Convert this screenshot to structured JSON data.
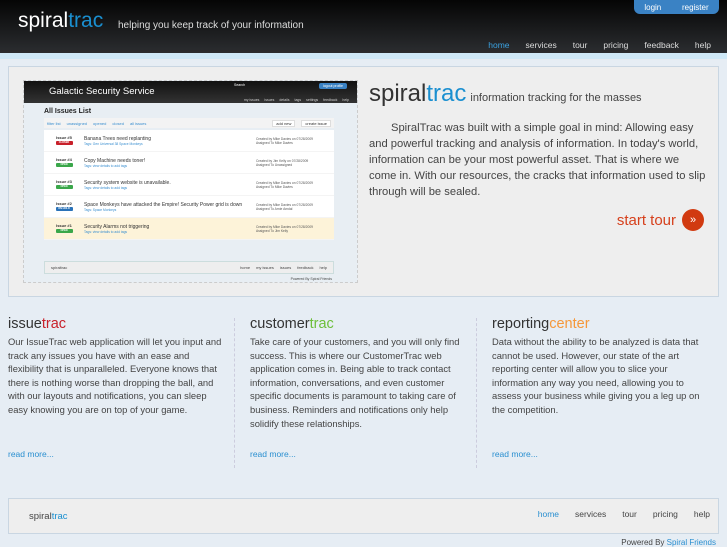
{
  "header": {
    "logo_a": "spiral",
    "logo_b": "trac",
    "tagline": "helping you keep track of your information",
    "login": "login",
    "register": "register",
    "nav": [
      "home",
      "services",
      "tour",
      "pricing",
      "feedback",
      "help"
    ],
    "active": "home"
  },
  "hero": {
    "title_a": "spiral",
    "title_b": "trac",
    "subtitle": "information tracking for the masses",
    "text": "SpiralTrac was built with a simple goal in mind: Allowing easy and powerful tracking and analysis of information. In today's world, information can be your most powerful asset. That is where we come in. With our resources, the cracks that information used to slip through will be sealed.",
    "cta": "start tour",
    "cta_icon": "»",
    "screenshot": {
      "title": "Galactic Security Service",
      "search": "Search",
      "auth": "logout  profile",
      "nav": [
        "my issues",
        "issues",
        "details",
        "tags",
        "settings",
        "feedback",
        "help"
      ],
      "list_title": "All Issues List",
      "filters": [
        "filter list",
        "unassigned",
        "opened",
        "closed",
        "all issues"
      ],
      "buttons": [
        "add new",
        "create issue"
      ],
      "issues": [
        {
          "num": "Issue #5",
          "status": "CLOSED",
          "color": "#c8202a",
          "title": "Banana Trees need replanting",
          "tags": "Tags:  Gen Universal 38  Space Monkeys",
          "created": "Created by Mike Davies on 07/28/2009",
          "assigned": "Assigned To Mike Davies"
        },
        {
          "num": "Issue #4",
          "status": "OPEN",
          "color": "#3aa74a",
          "title": "Copy Machine needs toner!",
          "tags": "Tags:  view details to add tags",
          "created": "Created by Jim Kelly on 07/28/2009",
          "assigned": "Assigned To Unassigned"
        },
        {
          "num": "Issue #3",
          "status": "OPEN",
          "color": "#3aa74a",
          "title": "Security system website is unavailable.",
          "tags": "Tags:  view details to add tags",
          "created": "Created by Mike Davies on 07/28/2009",
          "assigned": "Assigned To Mike Davies"
        },
        {
          "num": "Issue #2",
          "status": "ON HOLD",
          "color": "#2a72b8",
          "title": "Space Monkeys have attacked the Empire! Security Power grid is down",
          "tags": "Tags:  Space Monkeys",
          "created": "Created by Mike Davies on 07/28/2009",
          "assigned": "Assigned To Arnie Amdal"
        },
        {
          "num": "Issue #1",
          "status": "OPEN",
          "color": "#3aa74a",
          "title": "Security Alarms not triggering",
          "tags": "Tags:  view details to add tags",
          "created": "Created by Mike Davies on 07/28/2009",
          "assigned": "Assigned To Jim Kelly"
        }
      ],
      "footer_logo": "spiraltrac",
      "footer_nav": [
        "home",
        "my issues",
        "issues",
        "feedback",
        "help"
      ],
      "powered": "Powered By Spiral Friends"
    }
  },
  "columns": [
    {
      "title_a": "issue",
      "title_b": "trac",
      "accent": "#c8202a",
      "text": "Our IssueTrac web application will let you input and track any issues you have with an ease and flexibility that is unparalleled. Everyone knows that there is nothing worse than dropping the ball, and with our layouts and notifications, you can sleep easy knowing you are on top of your game.",
      "link": "read more..."
    },
    {
      "title_a": "customer",
      "title_b": "trac",
      "accent": "#6cbf3a",
      "text": "Take care of your customers, and you will only find success. This is where our CustomerTrac web application comes in. Being able to track contact information, conversations, and even customer specific documents is paramount to taking care of business. Reminders and notifications only help solidify these relationships.",
      "link": "read more..."
    },
    {
      "title_a": "reporting",
      "title_b": "center",
      "accent": "#f5983a",
      "text": "Data without the ability to be analyzed is data that cannot be used. However, our state of the art reporting center will allow you to slice your information any way you need, allowing you to assess your business while giving you a leg up on the competition.",
      "link": "read more..."
    }
  ],
  "footer": {
    "logo_a": "spiral",
    "logo_b": "trac",
    "nav": [
      "home",
      "services",
      "tour",
      "pricing",
      "help"
    ],
    "active": "home",
    "powered_label": "Powered By",
    "powered_link": "Spiral Friends"
  }
}
